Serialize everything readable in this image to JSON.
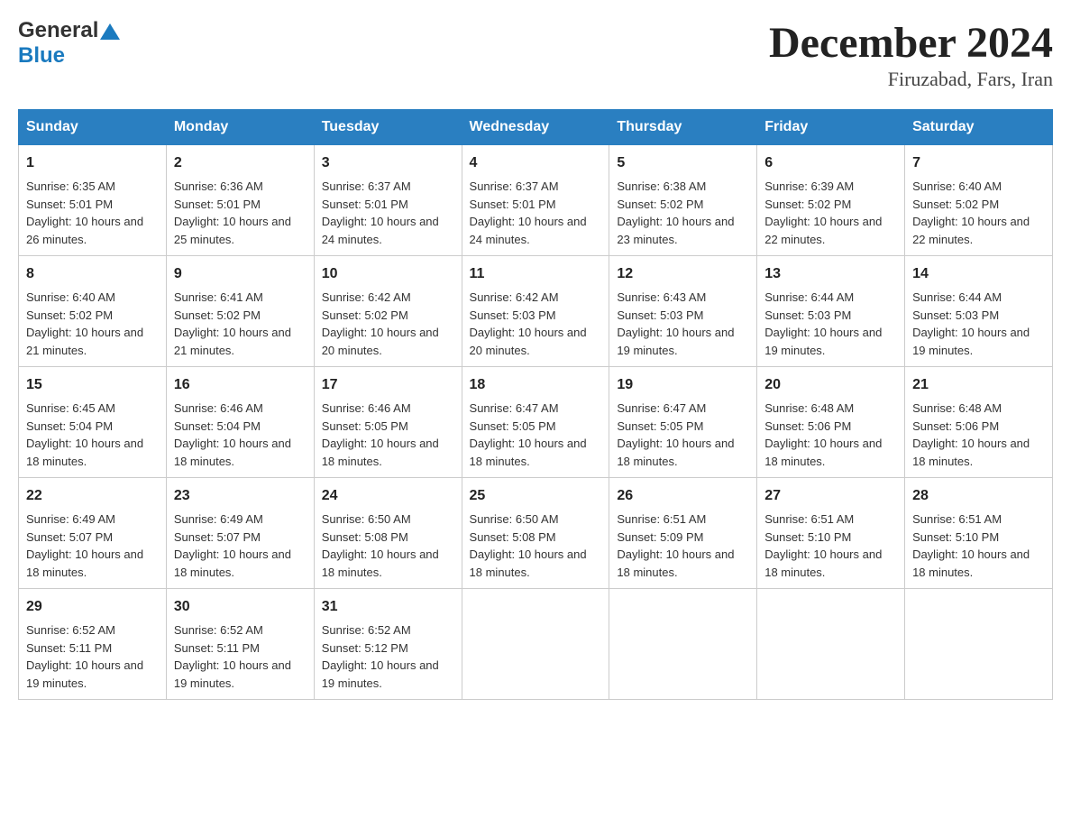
{
  "header": {
    "logo_general": "General",
    "logo_blue": "Blue",
    "title": "December 2024",
    "subtitle": "Firuzabad, Fars, Iran"
  },
  "days_of_week": [
    "Sunday",
    "Monday",
    "Tuesday",
    "Wednesday",
    "Thursday",
    "Friday",
    "Saturday"
  ],
  "weeks": [
    [
      {
        "day": "1",
        "sunrise": "6:35 AM",
        "sunset": "5:01 PM",
        "daylight": "10 hours and 26 minutes."
      },
      {
        "day": "2",
        "sunrise": "6:36 AM",
        "sunset": "5:01 PM",
        "daylight": "10 hours and 25 minutes."
      },
      {
        "day": "3",
        "sunrise": "6:37 AM",
        "sunset": "5:01 PM",
        "daylight": "10 hours and 24 minutes."
      },
      {
        "day": "4",
        "sunrise": "6:37 AM",
        "sunset": "5:01 PM",
        "daylight": "10 hours and 24 minutes."
      },
      {
        "day": "5",
        "sunrise": "6:38 AM",
        "sunset": "5:02 PM",
        "daylight": "10 hours and 23 minutes."
      },
      {
        "day": "6",
        "sunrise": "6:39 AM",
        "sunset": "5:02 PM",
        "daylight": "10 hours and 22 minutes."
      },
      {
        "day": "7",
        "sunrise": "6:40 AM",
        "sunset": "5:02 PM",
        "daylight": "10 hours and 22 minutes."
      }
    ],
    [
      {
        "day": "8",
        "sunrise": "6:40 AM",
        "sunset": "5:02 PM",
        "daylight": "10 hours and 21 minutes."
      },
      {
        "day": "9",
        "sunrise": "6:41 AM",
        "sunset": "5:02 PM",
        "daylight": "10 hours and 21 minutes."
      },
      {
        "day": "10",
        "sunrise": "6:42 AM",
        "sunset": "5:02 PM",
        "daylight": "10 hours and 20 minutes."
      },
      {
        "day": "11",
        "sunrise": "6:42 AM",
        "sunset": "5:03 PM",
        "daylight": "10 hours and 20 minutes."
      },
      {
        "day": "12",
        "sunrise": "6:43 AM",
        "sunset": "5:03 PM",
        "daylight": "10 hours and 19 minutes."
      },
      {
        "day": "13",
        "sunrise": "6:44 AM",
        "sunset": "5:03 PM",
        "daylight": "10 hours and 19 minutes."
      },
      {
        "day": "14",
        "sunrise": "6:44 AM",
        "sunset": "5:03 PM",
        "daylight": "10 hours and 19 minutes."
      }
    ],
    [
      {
        "day": "15",
        "sunrise": "6:45 AM",
        "sunset": "5:04 PM",
        "daylight": "10 hours and 18 minutes."
      },
      {
        "day": "16",
        "sunrise": "6:46 AM",
        "sunset": "5:04 PM",
        "daylight": "10 hours and 18 minutes."
      },
      {
        "day": "17",
        "sunrise": "6:46 AM",
        "sunset": "5:05 PM",
        "daylight": "10 hours and 18 minutes."
      },
      {
        "day": "18",
        "sunrise": "6:47 AM",
        "sunset": "5:05 PM",
        "daylight": "10 hours and 18 minutes."
      },
      {
        "day": "19",
        "sunrise": "6:47 AM",
        "sunset": "5:05 PM",
        "daylight": "10 hours and 18 minutes."
      },
      {
        "day": "20",
        "sunrise": "6:48 AM",
        "sunset": "5:06 PM",
        "daylight": "10 hours and 18 minutes."
      },
      {
        "day": "21",
        "sunrise": "6:48 AM",
        "sunset": "5:06 PM",
        "daylight": "10 hours and 18 minutes."
      }
    ],
    [
      {
        "day": "22",
        "sunrise": "6:49 AM",
        "sunset": "5:07 PM",
        "daylight": "10 hours and 18 minutes."
      },
      {
        "day": "23",
        "sunrise": "6:49 AM",
        "sunset": "5:07 PM",
        "daylight": "10 hours and 18 minutes."
      },
      {
        "day": "24",
        "sunrise": "6:50 AM",
        "sunset": "5:08 PM",
        "daylight": "10 hours and 18 minutes."
      },
      {
        "day": "25",
        "sunrise": "6:50 AM",
        "sunset": "5:08 PM",
        "daylight": "10 hours and 18 minutes."
      },
      {
        "day": "26",
        "sunrise": "6:51 AM",
        "sunset": "5:09 PM",
        "daylight": "10 hours and 18 minutes."
      },
      {
        "day": "27",
        "sunrise": "6:51 AM",
        "sunset": "5:10 PM",
        "daylight": "10 hours and 18 minutes."
      },
      {
        "day": "28",
        "sunrise": "6:51 AM",
        "sunset": "5:10 PM",
        "daylight": "10 hours and 18 minutes."
      }
    ],
    [
      {
        "day": "29",
        "sunrise": "6:52 AM",
        "sunset": "5:11 PM",
        "daylight": "10 hours and 19 minutes."
      },
      {
        "day": "30",
        "sunrise": "6:52 AM",
        "sunset": "5:11 PM",
        "daylight": "10 hours and 19 minutes."
      },
      {
        "day": "31",
        "sunrise": "6:52 AM",
        "sunset": "5:12 PM",
        "daylight": "10 hours and 19 minutes."
      },
      null,
      null,
      null,
      null
    ]
  ]
}
